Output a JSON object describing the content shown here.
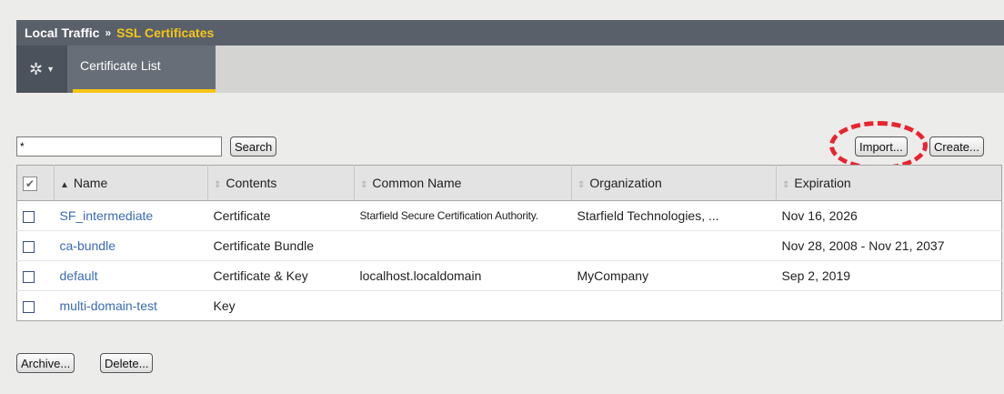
{
  "breadcrumb": {
    "parent": "Local Traffic",
    "separator": "»",
    "current": "SSL Certificates"
  },
  "tabs": {
    "gear_icon": "gear-icon",
    "active_tab": "Certificate List"
  },
  "search": {
    "value": "*",
    "button": "Search"
  },
  "actions": {
    "import": "Import...",
    "create": "Create..."
  },
  "table": {
    "headers": {
      "name": "Name",
      "contents": "Contents",
      "common_name": "Common Name",
      "organization": "Organization",
      "expiration": "Expiration"
    },
    "rows": [
      {
        "name": "SF_intermediate",
        "contents": "Certificate",
        "common_name": "Starfield Secure Certification Authority.",
        "organization": "Starfield Technologies, ...",
        "expiration": "Nov 16, 2026"
      },
      {
        "name": "ca-bundle",
        "contents": "Certificate Bundle",
        "common_name": "",
        "organization": "",
        "expiration": "Nov 28, 2008 - Nov 21, 2037"
      },
      {
        "name": "default",
        "contents": "Certificate & Key",
        "common_name": "localhost.localdomain",
        "organization": "MyCompany",
        "expiration": "Sep 2, 2019"
      },
      {
        "name": "multi-domain-test",
        "contents": "Key",
        "common_name": "",
        "organization": "",
        "expiration": ""
      }
    ]
  },
  "bottom_actions": {
    "archive": "Archive...",
    "delete": "Delete..."
  },
  "colors": {
    "title_bar": "#59606a",
    "accent": "#f5c518",
    "link": "#3a6bb8",
    "highlight": "#e8242f"
  }
}
